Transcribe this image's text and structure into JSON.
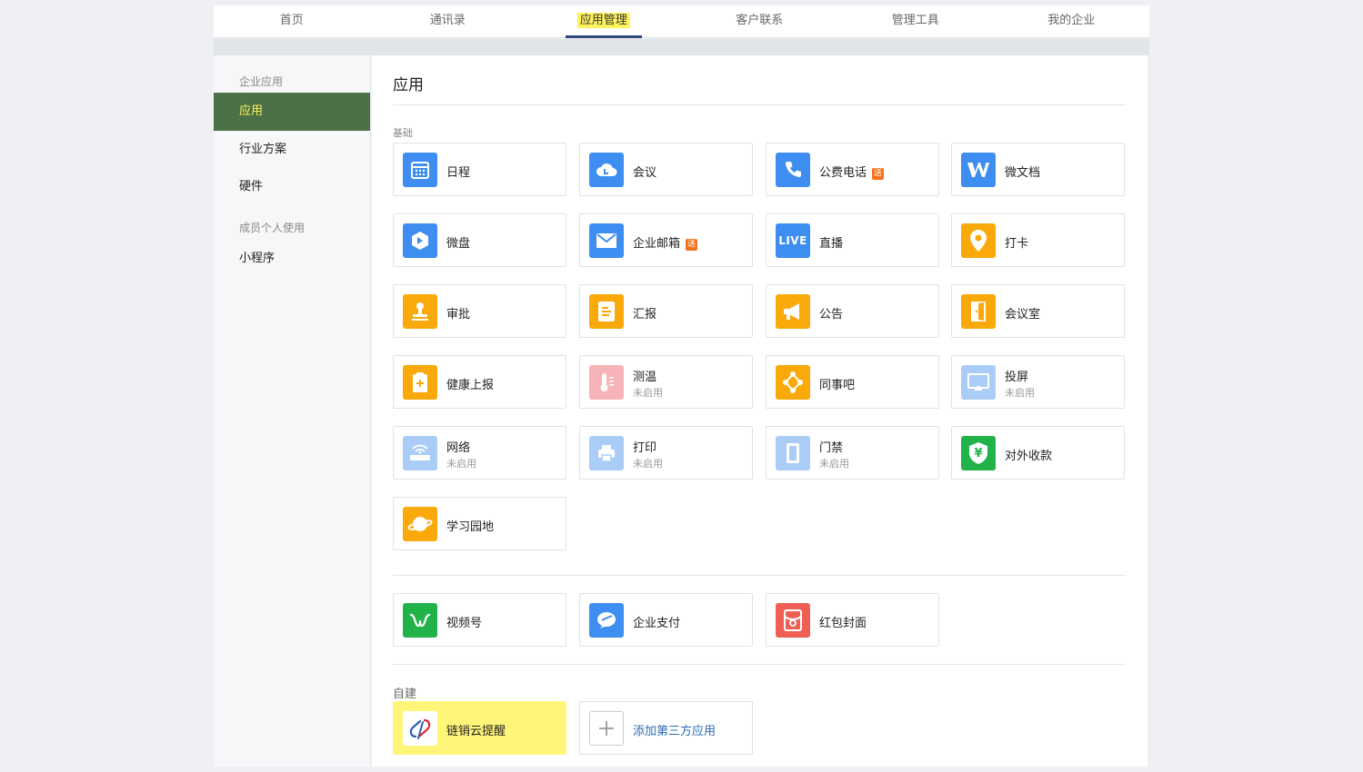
{
  "topnav": {
    "tabs": [
      {
        "label": "首页"
      },
      {
        "label": "通讯录"
      },
      {
        "label": "应用管理"
      },
      {
        "label": "客户联系"
      },
      {
        "label": "管理工具"
      },
      {
        "label": "我的企业"
      }
    ],
    "active_index": 2
  },
  "sidebar": {
    "group1": "企业应用",
    "items": [
      {
        "label": "应用"
      },
      {
        "label": "行业方案"
      },
      {
        "label": "硬件"
      }
    ],
    "group2": "成员个人使用",
    "items2": [
      {
        "label": "小程序"
      }
    ]
  },
  "main": {
    "title": "应用",
    "section_basic": "基础",
    "section_custom": "自建",
    "apps": [
      {
        "name": "日程",
        "icon": "calendar-icon",
        "color": "#3d8ef0"
      },
      {
        "name": "会议",
        "icon": "cloud-icon",
        "color": "#3d8ef0"
      },
      {
        "name": "公费电话",
        "icon": "phone-icon",
        "color": "#3d8ef0",
        "badge": "送"
      },
      {
        "name": "微文档",
        "icon": "w-doc-icon",
        "color": "#3d8ef0"
      },
      {
        "name": "微盘",
        "icon": "drive-icon",
        "color": "#3d8ef0"
      },
      {
        "name": "企业邮箱",
        "icon": "mail-icon",
        "color": "#3d8ef0",
        "badge": "送"
      },
      {
        "name": "直播",
        "icon": "live-icon",
        "color": "#3d8ef0",
        "icon_text": "LIVE"
      },
      {
        "name": "打卡",
        "icon": "location-pin-icon",
        "color": "#f9a90a"
      },
      {
        "name": "审批",
        "icon": "stamp-icon",
        "color": "#f9a90a"
      },
      {
        "name": "汇报",
        "icon": "report-icon",
        "color": "#f9a90a"
      },
      {
        "name": "公告",
        "icon": "megaphone-icon",
        "color": "#f9a90a"
      },
      {
        "name": "会议室",
        "icon": "door-icon",
        "color": "#f9a90a"
      },
      {
        "name": "健康上报",
        "icon": "health-clipboard-icon",
        "color": "#f9a90a"
      },
      {
        "name": "测温",
        "sub": "未启用",
        "icon": "thermometer-icon",
        "color": "#f7b4b8"
      },
      {
        "name": "同事吧",
        "icon": "network-nodes-icon",
        "color": "#f9a90a"
      },
      {
        "name": "投屏",
        "sub": "未启用",
        "icon": "screen-cast-icon",
        "color": "#a9cdf6"
      },
      {
        "name": "网络",
        "sub": "未启用",
        "icon": "router-icon",
        "color": "#a9cdf6"
      },
      {
        "name": "打印",
        "sub": "未启用",
        "icon": "printer-icon",
        "color": "#a9cdf6"
      },
      {
        "name": "门禁",
        "sub": "未启用",
        "icon": "access-door-icon",
        "color": "#a9cdf6"
      },
      {
        "name": "对外收款",
        "icon": "yuan-shield-icon",
        "color": "#22b24a",
        "icon_text": "¥"
      },
      {
        "name": "学习园地",
        "icon": "planet-icon",
        "color": "#f9a90a"
      }
    ],
    "apps2": [
      {
        "name": "视频号",
        "icon": "channels-icon",
        "color": "#22b24a"
      },
      {
        "name": "企业支付",
        "icon": "pay-icon",
        "color": "#3d8ef0"
      },
      {
        "name": "红包封面",
        "icon": "red-envelope-icon",
        "color": "#ee5f55"
      }
    ],
    "custom_apps": [
      {
        "name": "链销云提醒",
        "icon": "linkxiao-logo-icon"
      },
      {
        "name": "添加第三方应用",
        "icon": "plus-icon"
      }
    ]
  }
}
